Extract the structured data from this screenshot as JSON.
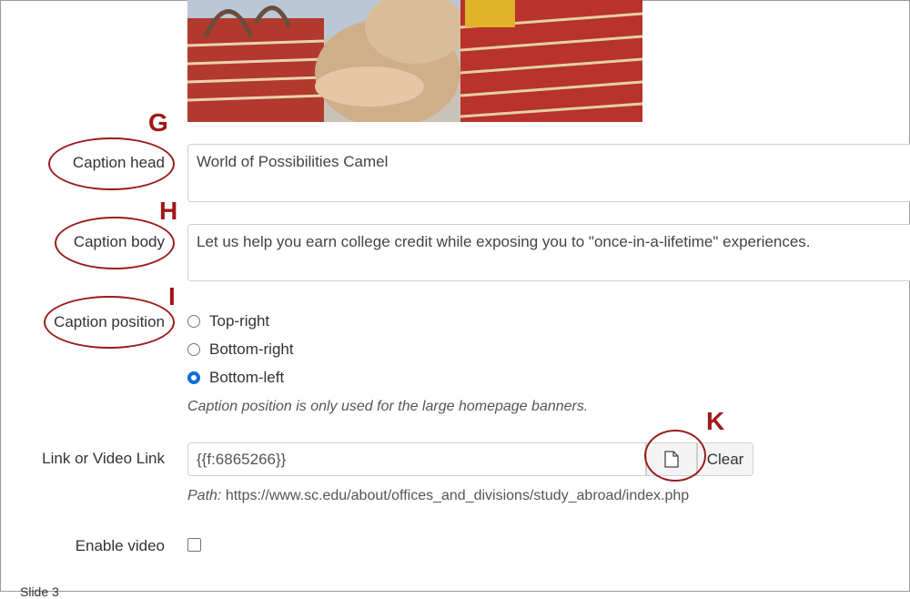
{
  "form": {
    "caption_head": {
      "label": "Caption head",
      "value": "World of Possibilities Camel"
    },
    "caption_body": {
      "label": "Caption body",
      "value": "Let us help you earn college credit while exposing you to \"once-in-a-lifetime\" experiences."
    },
    "caption_position": {
      "label": "Caption position",
      "options": [
        "Top-right",
        "Bottom-right",
        "Bottom-left"
      ],
      "selected": "Bottom-left",
      "help": "Caption position is only used for the large homepage banners."
    },
    "link": {
      "label": "Link or Video Link",
      "value": "{{f:6865266}}",
      "clear_label": "Clear",
      "path_label": "Path:",
      "path_value": "https://www.sc.edu/about/offices_and_divisions/study_abroad/index.php"
    },
    "enable_video": {
      "label": "Enable video",
      "checked": false
    },
    "next_section_label": "Slide 3"
  },
  "annotations": {
    "g": "G",
    "h": "H",
    "i": "I",
    "k": "K"
  },
  "colors": {
    "annotation": "#9b1c1c",
    "radio_selected": "#0a6fd8"
  },
  "icons": {
    "file_browse": "document-icon"
  }
}
